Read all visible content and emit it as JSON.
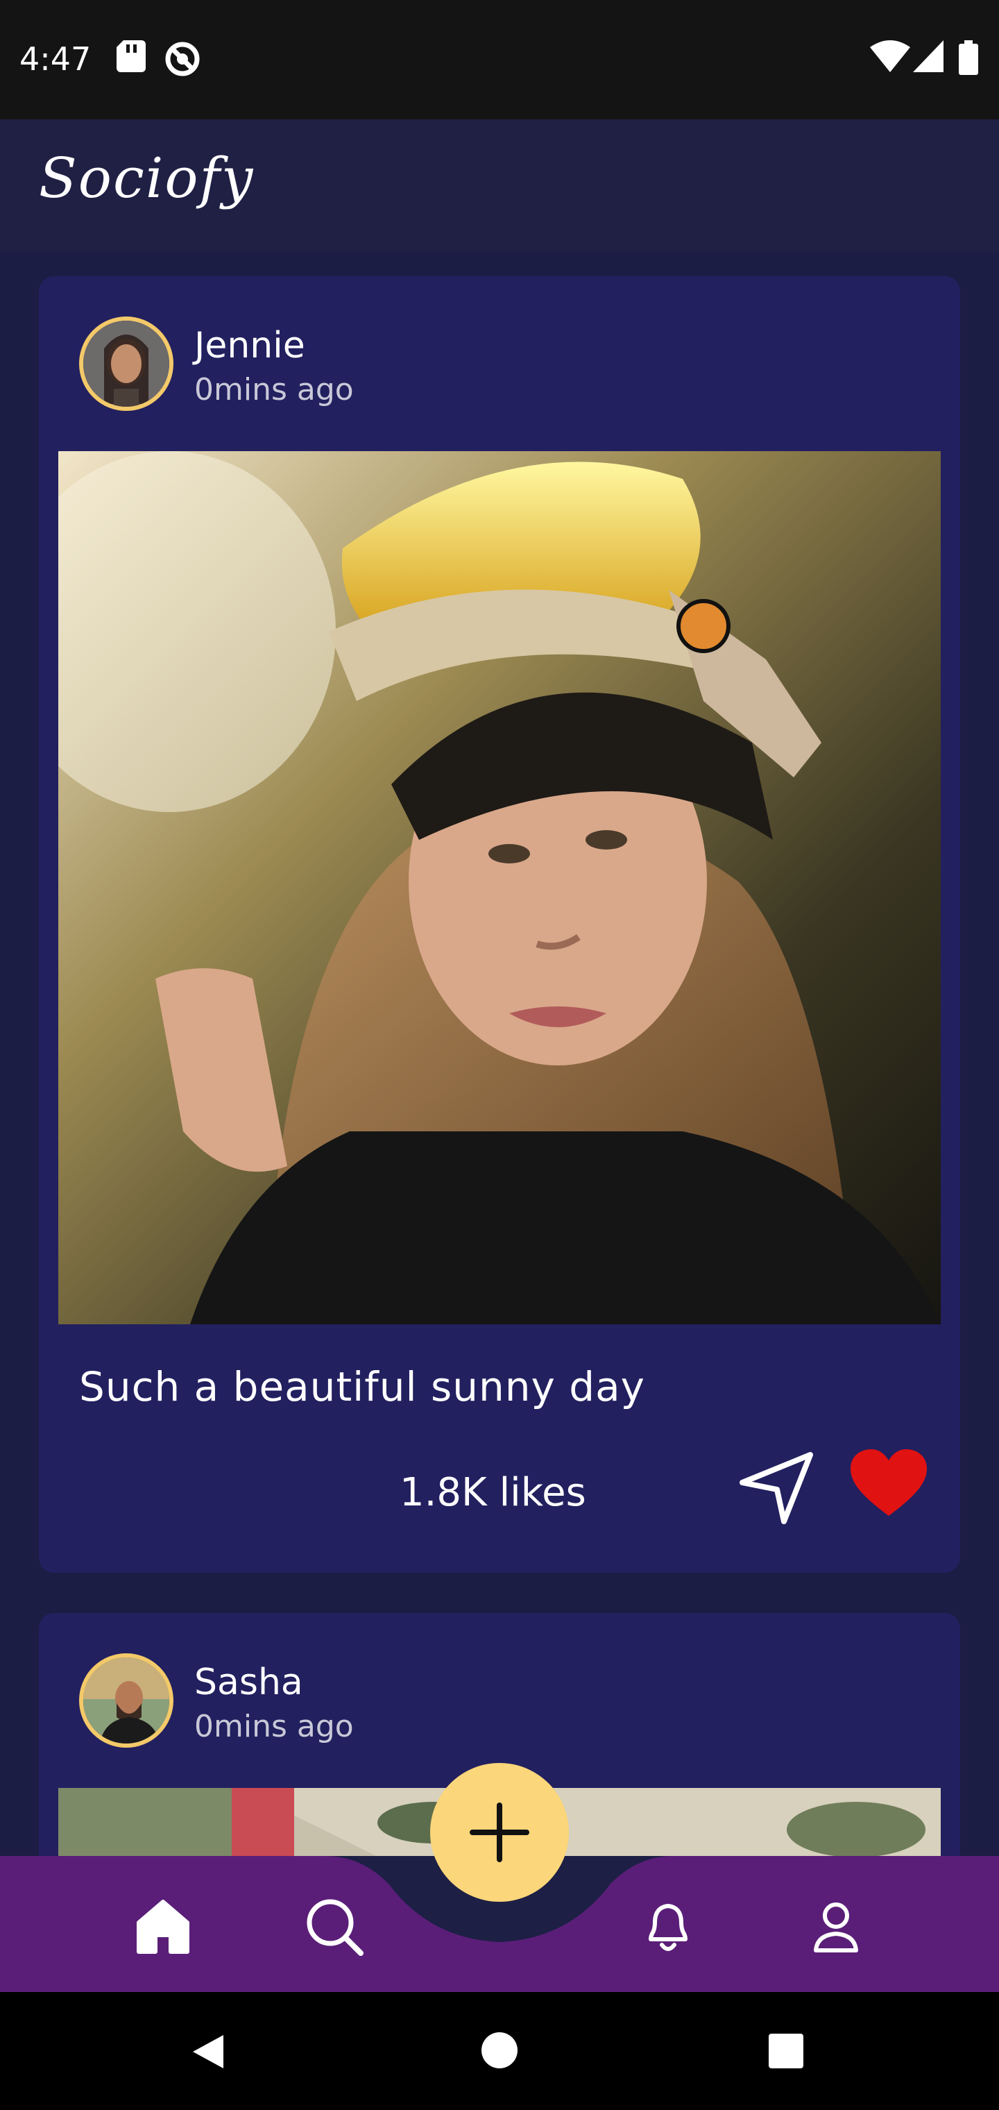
{
  "status": {
    "time": "4:47"
  },
  "app": {
    "title": "Sociofy"
  },
  "posts": [
    {
      "username": "Jennie",
      "time": "0mins ago",
      "caption": "Such a beautiful sunny day",
      "likes": "1.8K likes"
    },
    {
      "username": "Sasha",
      "time": "0mins ago"
    }
  ],
  "nav": {
    "items": [
      "home-icon",
      "search-icon",
      "add-icon",
      "notifications-icon",
      "profile-icon"
    ],
    "active": "home"
  },
  "colors": {
    "background": "#1c1d44",
    "card": "#22205f",
    "fab": "#fbd67a",
    "nav": "#5a1e78",
    "heart": "#e01212"
  }
}
